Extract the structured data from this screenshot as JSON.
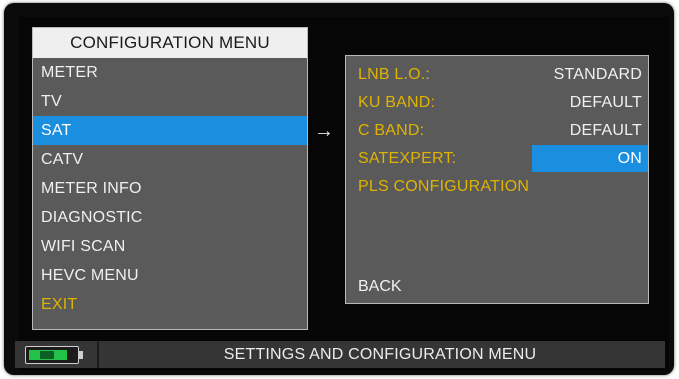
{
  "menu": {
    "title": "CONFIGURATION MENU",
    "items": [
      {
        "label": "METER"
      },
      {
        "label": "TV"
      },
      {
        "label": "SAT",
        "selected": true
      },
      {
        "label": "CATV"
      },
      {
        "label": "METER INFO"
      },
      {
        "label": "DIAGNOSTIC"
      },
      {
        "label": "WIFI SCAN"
      },
      {
        "label": "HEVC MENU"
      },
      {
        "label": "EXIT"
      }
    ]
  },
  "arrow": "→",
  "sat_menu": {
    "rows": [
      {
        "label": "LNB L.O.:",
        "value": "STANDARD"
      },
      {
        "label": "KU BAND:",
        "value": "DEFAULT"
      },
      {
        "label": "C BAND:",
        "value": "DEFAULT"
      },
      {
        "label": "SATEXPERT:",
        "value": "ON",
        "selected": true
      },
      {
        "label": "PLS CONFIGURATION",
        "value": ""
      }
    ],
    "back": "BACK"
  },
  "status_bar": {
    "icon": "battery-charging-icon",
    "text": "SETTINGS AND CONFIGURATION MENU"
  },
  "colors": {
    "selection": "#1a8fe0",
    "label_yellow": "#e0b300",
    "panel": "#5a5a5a",
    "battery_green": "#22c24a"
  }
}
